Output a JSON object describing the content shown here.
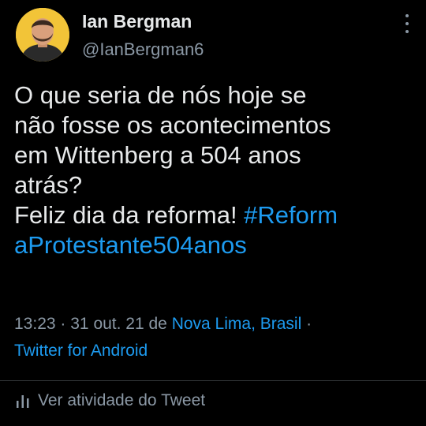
{
  "author": {
    "name": "Ian Bergman",
    "handle": "@IanBergman6"
  },
  "tweet": {
    "line1": "O que seria de nós hoje se",
    "line2": "não fosse os acontecimentos",
    "line3": "em Wittenberg a 504 anos",
    "line4": "atrás?",
    "line5_text": "Feliz dia da reforma! ",
    "line5_hashtag": "#Reform",
    "line6_hashtag": "aProtestante504anos"
  },
  "meta": {
    "time": "13:23",
    "date": "31 out. 21 de",
    "location": "Nova Lima, Brasil",
    "source": "Twitter for Android",
    "separator": "·"
  },
  "activity": {
    "label": "Ver atividade do Tweet",
    "icon": "analytics-icon"
  },
  "colors": {
    "background": "#000000",
    "text": "#e7e9ea",
    "secondary": "#8b98a5",
    "accent": "#1d9bf0",
    "avatar_bg": "#f2c438"
  }
}
